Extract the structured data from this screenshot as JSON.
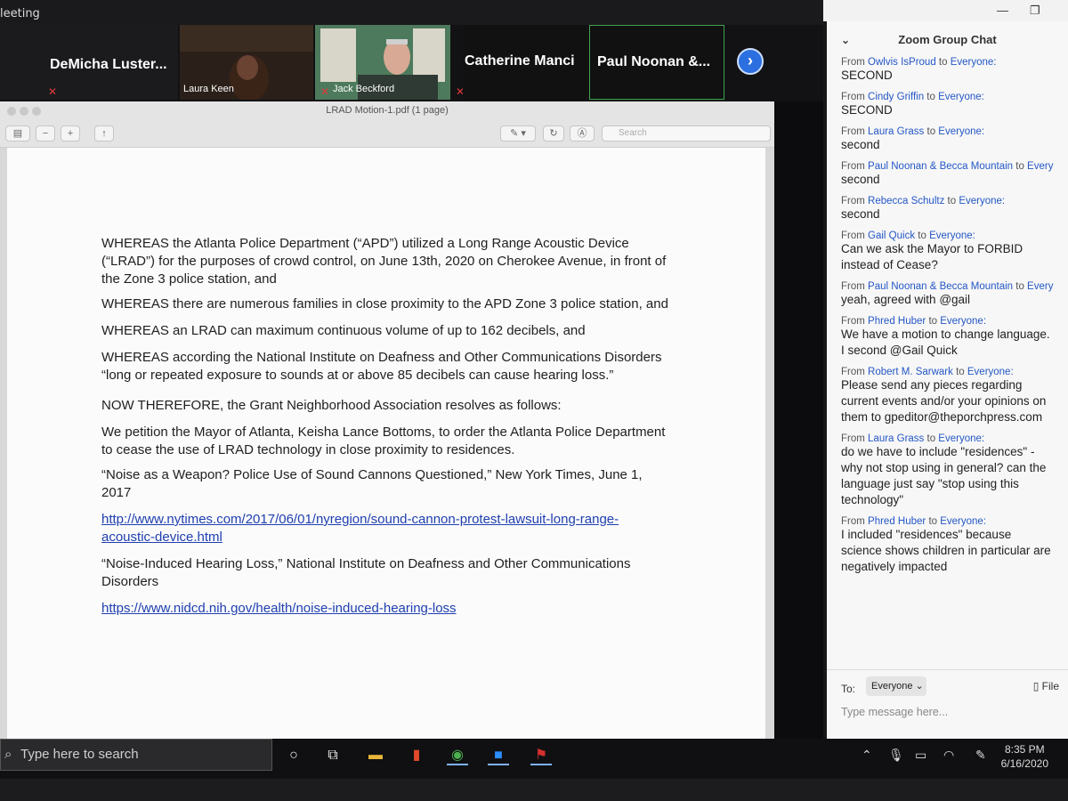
{
  "zoom": {
    "window_title": "leeting",
    "participants": [
      {
        "name": "DeMicha  Luster..."
      },
      {
        "caption": "Laura Keen"
      },
      {
        "caption": "Jack Beckford"
      },
      {
        "name": "Catherine Manci"
      },
      {
        "name": "Paul  Noonan &..."
      }
    ]
  },
  "pdf": {
    "window_title": "LRAD Motion-1.pdf (1 page)",
    "search_placeholder": "Search",
    "lines": [
      "WHEREAS the Atlanta Police Department (“APD”) utilized a Long Range Acoustic Device",
      "(“LRAD”) for the purposes of crowd control, on June 13th, 2020 on Cherokee Avenue, in front of",
      "the Zone 3 police station, and",
      "WHEREAS there are numerous families in close proximity to the APD Zone 3 police station, and",
      "WHEREAS an LRAD can maximum continuous volume of up to 162 decibels, and",
      "WHEREAS according the National Institute on Deafness and Other Communications Disorders",
      "“long or repeated exposure to sounds at or above 85 decibels can cause hearing loss.”",
      "NOW THEREFORE, the Grant Neighborhood Association resolves as follows:",
      "We petition the Mayor of Atlanta, Keisha Lance Bottoms, to order the Atlanta Police Department",
      "to cease the use of LRAD technology in close proximity to residences.",
      "“Noise as a Weapon? Police Use of Sound Cannons Questioned,” New York Times, June 1,",
      "2017",
      "http://www.nytimes.com/2017/06/01/nyregion/sound-cannon-protest-lawsuit-long-range-",
      "acoustic-device.html",
      "“Noise-Induced Hearing Loss,” National Institute on Deafness and Other Communications",
      "Disorders",
      "https://www.nidcd.nih.gov/health/noise-induced-hearing-loss"
    ]
  },
  "chat": {
    "title": "Zoom Group Chat",
    "messages": [
      {
        "from": "Owlvis IsProud",
        "to": "Everyone:",
        "text": "SECOND"
      },
      {
        "from": "Cindy Griffin",
        "to": "Everyone:",
        "text": "SECOND"
      },
      {
        "from": "Laura Grass",
        "to": "Everyone:",
        "text": "second"
      },
      {
        "from": "Paul Noonan & Becca Mountain",
        "to": "Everyone",
        "text": "second"
      },
      {
        "from": "Rebecca Schultz",
        "to": "Everyone:",
        "text": "second"
      },
      {
        "from": "Gail Quick",
        "to": "Everyone:",
        "text": "Can we ask the Mayor to FORBID instead of Cease?"
      },
      {
        "from": "Paul Noonan & Becca Mountain",
        "to": "Everyone",
        "text": "yeah, agreed with @gail"
      },
      {
        "from": "Phred Huber",
        "to": "Everyone:",
        "text": "We have a motion to change language. I second @Gail Quick"
      },
      {
        "from": "Robert M. Sarwark",
        "to": "Everyone:",
        "text": "Please send any pieces regarding current events and/or your opinions on them to gpeditor@theporchpress.com"
      },
      {
        "from": "Laura Grass",
        "to": "Everyone:",
        "text": "do we have to include \"residences\" - why not stop using in general? can the language just say \"stop using this technology\""
      },
      {
        "from": "Phred Huber",
        "to": "Everyone:",
        "text": "I included \"residences\" because science shows children in particular are negatively impacted"
      }
    ],
    "to_label": "To:",
    "to_value": "Everyone",
    "file_label": "File",
    "input_placeholder": "Type message here..."
  },
  "taskbar": {
    "search_placeholder": "Type here to search",
    "time": "8:35 PM",
    "date": "6/16/2020"
  }
}
